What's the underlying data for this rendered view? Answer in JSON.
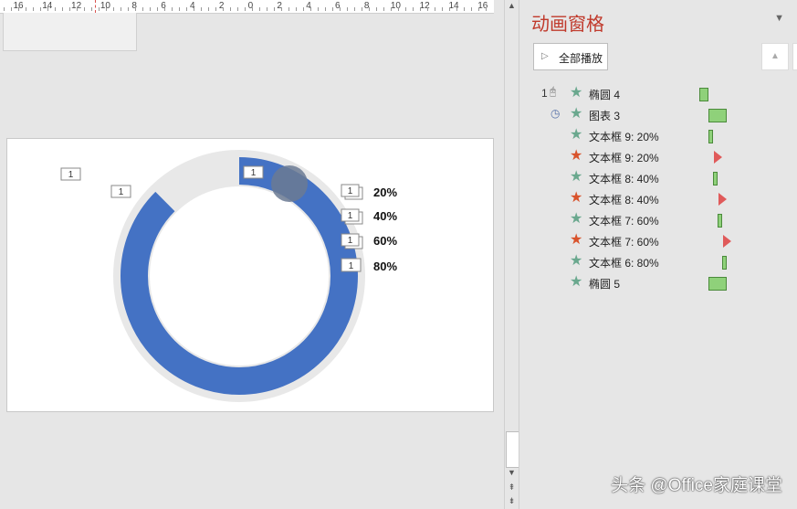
{
  "ruler": {
    "labels": [
      "16",
      "14",
      "12",
      "10",
      "8",
      "6",
      "4",
      "2",
      "0",
      "2",
      "4",
      "6",
      "8",
      "10",
      "12",
      "14",
      "16"
    ]
  },
  "slide": {
    "loose_tags": [
      "1",
      "1",
      "1"
    ],
    "legend": [
      {
        "tag": "1",
        "label": "20%"
      },
      {
        "tag": "1",
        "label": "40%"
      },
      {
        "tag": "1",
        "label": "60%"
      },
      {
        "tag": "1",
        "label": "80%"
      }
    ],
    "donut": {
      "progress_fraction": 0.875,
      "fill_color": "#4472c4",
      "track_color": "#e8e8e8",
      "marker_color": "#6b7a93"
    }
  },
  "pane": {
    "title": "动画窗格",
    "menu_icon": "triangle-down",
    "play_all_label": "全部播放",
    "items": [
      {
        "order": "1",
        "trigger": "mouse-click-icon",
        "star": "#6aa88e",
        "name": "椭圆 4",
        "bar": "box"
      },
      {
        "order": "",
        "trigger": "clock-icon",
        "star": "#6aa88e",
        "name": "图表 3",
        "bar": "box"
      },
      {
        "order": "",
        "trigger": "",
        "star": "#6aa88e",
        "name": "文本框 9: 20%",
        "bar": "box"
      },
      {
        "order": "",
        "trigger": "",
        "star": "#d9532c",
        "name": "文本框 9: 20%",
        "bar": "triangle"
      },
      {
        "order": "",
        "trigger": "",
        "star": "#6aa88e",
        "name": "文本框 8: 40%",
        "bar": "box"
      },
      {
        "order": "",
        "trigger": "",
        "star": "#d9532c",
        "name": "文本框 8: 40%",
        "bar": "triangle"
      },
      {
        "order": "",
        "trigger": "",
        "star": "#6aa88e",
        "name": "文本框 7: 60%",
        "bar": "box"
      },
      {
        "order": "",
        "trigger": "",
        "star": "#d9532c",
        "name": "文本框 7: 60%",
        "bar": "triangle"
      },
      {
        "order": "",
        "trigger": "",
        "star": "#6aa88e",
        "name": "文本框 6: 80%",
        "bar": "box"
      },
      {
        "order": "",
        "trigger": "",
        "star": "#6aa88e",
        "name": "椭圆 5",
        "bar": "box"
      }
    ]
  },
  "watermark": "头条 @Office家庭课堂"
}
